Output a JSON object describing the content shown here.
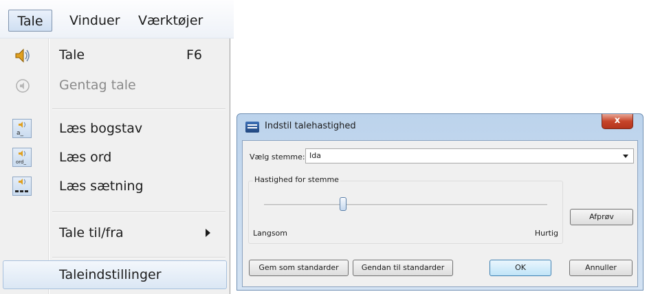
{
  "menubar": {
    "items": [
      "Tale",
      "Vinduer",
      "Værktøjer"
    ]
  },
  "menu": {
    "items": [
      {
        "label": "Tale",
        "shortcut": "F6",
        "icon": "speaker-icon"
      },
      {
        "label": "Gentag tale",
        "disabled": true,
        "icon": "repeat-speech-icon"
      },
      {
        "label": "Læs bogstav",
        "icon": "read-letter-icon"
      },
      {
        "label": "Læs ord",
        "icon": "read-word-icon"
      },
      {
        "label": "Læs sætning",
        "icon": "read-sentence-icon"
      },
      {
        "label": "Tale til/fra",
        "submenu": true
      },
      {
        "label": "Taleindstillinger",
        "highlighted": true
      }
    ]
  },
  "dialog": {
    "title": "Indstil talehastighed",
    "close_label": "x",
    "voice_label": "Vælg stemme:",
    "voice_value": "Ida",
    "speed_group_title": "Hastighed for stemme",
    "slider_min_label": "Langsom",
    "slider_max_label": "Hurtig",
    "slider_value_fraction": 0.28,
    "buttons": {
      "test": "Afprøv",
      "save_default": "Gem som standarder",
      "restore_default": "Gendan til standarder",
      "ok": "OK",
      "cancel": "Annuller"
    }
  },
  "colors": {
    "speaker_accent": "#e0a020",
    "dialog_frame": "#bcd3ec",
    "close_button": "#c7452a"
  }
}
